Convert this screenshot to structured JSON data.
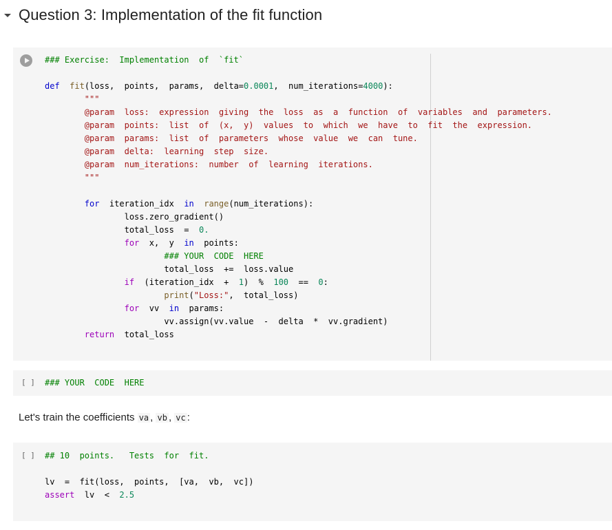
{
  "section": {
    "title": "Question 3: Implementation of the fit function",
    "collapse_icon": "caret-down-icon"
  },
  "cells": [
    {
      "type": "code",
      "run_icon": "play-circle-icon",
      "lines": {
        "l1": "### Exercise:  Implementation  of  `fit`",
        "l3_def": "def",
        "l3_fn": "fit",
        "l3_args_a": "(loss,  points,  params,  delta=",
        "l3_num1": "0.0001",
        "l3_args_b": ",  num_iterations=",
        "l3_num2": "4000",
        "l3_end": "):",
        "doc_open": "        \"\"\"",
        "doc1": "        @param  loss:  expression  giving  the  loss  as  a  function  of  variables  and  parameters.",
        "doc2": "        @param  points:  list  of  (x,  y)  values  to  which  we  have  to  fit  the  expression.",
        "doc3": "        @param  params:  list  of  parameters  whose  value  we  can  tune.",
        "doc4": "        @param  delta:  learning  step  size.",
        "doc5": "        @param  num_iterations:  number  of  learning  iterations.",
        "doc_close": "        \"\"\"",
        "for1_kw": "for",
        "for1_a": "  iteration_idx  ",
        "for1_in": "in",
        "for1_range": "range",
        "for1_b": "(num_iterations):",
        "zero_grad": "loss.zero_gradient()",
        "total_a": "total_loss  =  ",
        "total_num": "0.",
        "for2_kw": "for",
        "for2_a": "  x,  y  ",
        "for2_in": "in",
        "for2_b": "  points:",
        "your_code": "### YOUR  CODE  HERE",
        "accum": "total_loss  +=  loss.value",
        "if_kw": "if",
        "if_a": "  (iteration_idx  +  ",
        "if_n1": "1",
        "if_b": ")  %  ",
        "if_n2": "100",
        "if_c": "  ==  ",
        "if_n3": "0",
        "if_d": ":",
        "print_fn": "print",
        "print_a": "(",
        "print_str": "\"Loss:\"",
        "print_b": ",  total_loss)",
        "for3_kw": "for",
        "for3_a": "  vv  ",
        "for3_in": "in",
        "for3_b": "  params:",
        "assign": "vv.assign(vv.value  -  delta  *  vv.gradient)",
        "ret_kw": "return",
        "ret_a": "  total_loss"
      }
    },
    {
      "type": "code",
      "bracket": "[ ]",
      "lines": {
        "l1": "### YOUR  CODE  HERE"
      }
    },
    {
      "type": "markdown",
      "text_before": "Let's train the coefficients ",
      "codes": [
        "va",
        "vb",
        "vc"
      ],
      "sep": ", ",
      "text_after": ":"
    },
    {
      "type": "code",
      "bracket": "[ ]",
      "lines": {
        "l1": "## 10  points.   Tests  for  fit.",
        "l3": "lv  =  fit(loss,  points,  [va,  vb,  vc])",
        "l4_kw": "assert",
        "l4_a": "  lv  <  ",
        "l4_num": "2.5"
      }
    }
  ]
}
